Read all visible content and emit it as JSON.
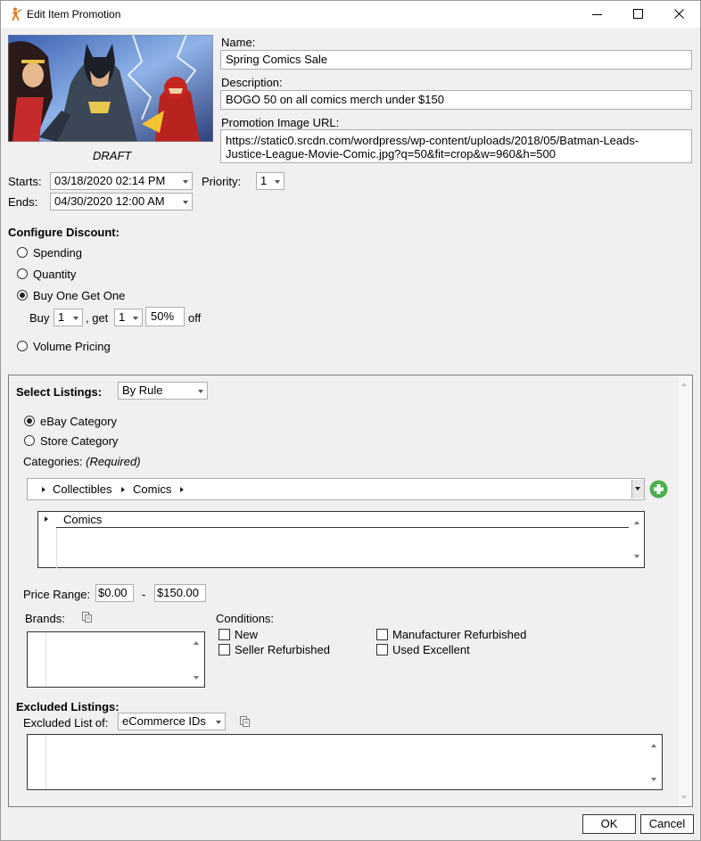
{
  "window": {
    "title": "Edit Item Promotion"
  },
  "image": {
    "status": "DRAFT"
  },
  "fields": {
    "name_label": "Name:",
    "name_value": "Spring Comics Sale",
    "description_label": "Description:",
    "description_value": "BOGO 50 on all comics merch under $150",
    "image_url_label": "Promotion Image URL:",
    "image_url_line1": "https://static0.srcdn.com/wordpress/wp-content/uploads/2018/05/Batman-Leads-",
    "image_url_line2": "Justice-League-Movie-Comic.jpg?q=50&fit=crop&w=960&h=500"
  },
  "schedule": {
    "starts_label": "Starts:",
    "starts_value": "03/18/2020 02:14 PM",
    "ends_label": "Ends:",
    "ends_value": "04/30/2020 12:00 AM",
    "priority_label": "Priority:",
    "priority_value": "1"
  },
  "discount": {
    "heading": "Configure Discount:",
    "options": [
      "Spending",
      "Quantity",
      "Buy One Get One",
      "Volume Pricing"
    ],
    "selected": "Buy One Get One",
    "bogo": {
      "buy_label": "Buy",
      "buy_value": "1",
      "get_label": ", get",
      "get_value": "1",
      "percent_value": "50%",
      "off_label": "off"
    }
  },
  "listings": {
    "heading": "Select Listings:",
    "mode_value": "By Rule",
    "category_sources": [
      "eBay Category",
      "Store Category"
    ],
    "selected_source": "eBay Category",
    "categories_label": "Categories:",
    "categories_required": "(Required)",
    "breadcrumb": [
      "Collectibles",
      "Comics"
    ],
    "category_list": [
      "Comics"
    ],
    "price_range_label": "Price Range:",
    "price_min": "$0.00",
    "price_sep": "-",
    "price_max": "$150.00",
    "brands_label": "Brands:",
    "conditions_label": "Conditions:",
    "conditions": [
      "New",
      "Seller Refurbished",
      "Manufacturer Refurbished",
      "Used Excellent"
    ]
  },
  "excluded": {
    "heading": "Excluded Listings:",
    "list_of_label": "Excluded List of:",
    "list_of_value": "eCommerce IDs"
  },
  "buttons": {
    "ok": "OK",
    "cancel": "Cancel"
  },
  "colors": {
    "add_button": "#4caf50",
    "window_bg": "#f0f0f0"
  }
}
